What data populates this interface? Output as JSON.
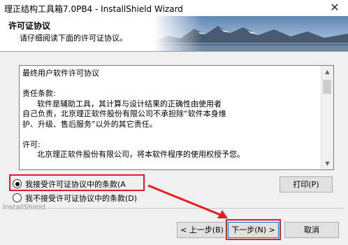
{
  "window": {
    "title": "理正结构工具箱7.0PB4 - InstallShield Wizard",
    "close_glyph": "✕"
  },
  "banner": {
    "heading": "许可证协议",
    "subheading": "请仔细阅读下面的许可证协议。"
  },
  "license": {
    "lines": [
      "最终用户软件许可协议",
      "",
      "责任条款:",
      "      软件是辅助工具，其计算与设计结果的正确性由使用者",
      "自己负责，北京理正软件股份有限公司不承担除“软件本身维",
      "护、升级、售后服务”以外的其它责任。",
      "",
      "许可:",
      "      北京理正软件股份有限公司，将本软件程序的使用权授予您。"
    ]
  },
  "options": {
    "accept_label": "我接受许可证协议中的条款(A",
    "decline_label": "我不接受许可证协议中的条款(D)",
    "selected": "accept"
  },
  "buttons": {
    "print": "打印(P)",
    "back": "< 上一步(B)",
    "next": "下一步(N) >",
    "cancel": "取消"
  },
  "footer": {
    "brand": "InstallShield"
  },
  "colors": {
    "highlight": "#e02020",
    "arrow": "#e02020"
  }
}
